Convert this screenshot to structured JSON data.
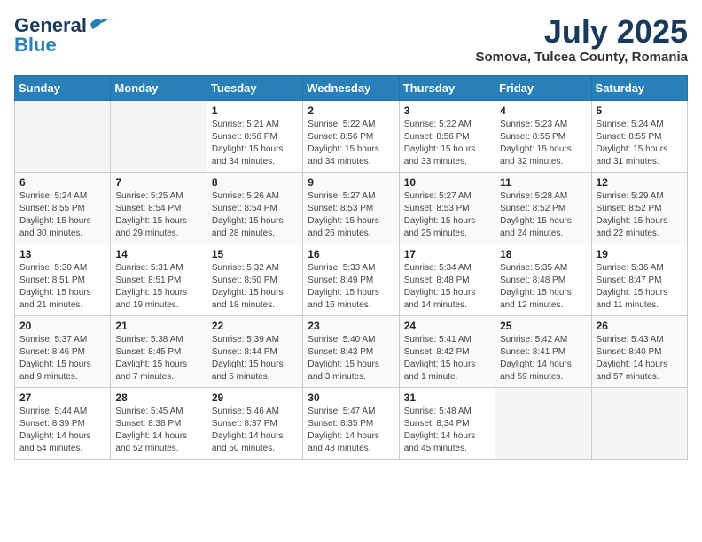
{
  "header": {
    "logo_general": "General",
    "logo_blue": "Blue",
    "title": "July 2025",
    "location": "Somova, Tulcea County, Romania"
  },
  "calendar": {
    "days_of_week": [
      "Sunday",
      "Monday",
      "Tuesday",
      "Wednesday",
      "Thursday",
      "Friday",
      "Saturday"
    ],
    "weeks": [
      [
        {
          "day": "",
          "info": ""
        },
        {
          "day": "",
          "info": ""
        },
        {
          "day": "1",
          "info": "Sunrise: 5:21 AM\nSunset: 8:56 PM\nDaylight: 15 hours and 34 minutes."
        },
        {
          "day": "2",
          "info": "Sunrise: 5:22 AM\nSunset: 8:56 PM\nDaylight: 15 hours and 34 minutes."
        },
        {
          "day": "3",
          "info": "Sunrise: 5:22 AM\nSunset: 8:56 PM\nDaylight: 15 hours and 33 minutes."
        },
        {
          "day": "4",
          "info": "Sunrise: 5:23 AM\nSunset: 8:55 PM\nDaylight: 15 hours and 32 minutes."
        },
        {
          "day": "5",
          "info": "Sunrise: 5:24 AM\nSunset: 8:55 PM\nDaylight: 15 hours and 31 minutes."
        }
      ],
      [
        {
          "day": "6",
          "info": "Sunrise: 5:24 AM\nSunset: 8:55 PM\nDaylight: 15 hours and 30 minutes."
        },
        {
          "day": "7",
          "info": "Sunrise: 5:25 AM\nSunset: 8:54 PM\nDaylight: 15 hours and 29 minutes."
        },
        {
          "day": "8",
          "info": "Sunrise: 5:26 AM\nSunset: 8:54 PM\nDaylight: 15 hours and 28 minutes."
        },
        {
          "day": "9",
          "info": "Sunrise: 5:27 AM\nSunset: 8:53 PM\nDaylight: 15 hours and 26 minutes."
        },
        {
          "day": "10",
          "info": "Sunrise: 5:27 AM\nSunset: 8:53 PM\nDaylight: 15 hours and 25 minutes."
        },
        {
          "day": "11",
          "info": "Sunrise: 5:28 AM\nSunset: 8:52 PM\nDaylight: 15 hours and 24 minutes."
        },
        {
          "day": "12",
          "info": "Sunrise: 5:29 AM\nSunset: 8:52 PM\nDaylight: 15 hours and 22 minutes."
        }
      ],
      [
        {
          "day": "13",
          "info": "Sunrise: 5:30 AM\nSunset: 8:51 PM\nDaylight: 15 hours and 21 minutes."
        },
        {
          "day": "14",
          "info": "Sunrise: 5:31 AM\nSunset: 8:51 PM\nDaylight: 15 hours and 19 minutes."
        },
        {
          "day": "15",
          "info": "Sunrise: 5:32 AM\nSunset: 8:50 PM\nDaylight: 15 hours and 18 minutes."
        },
        {
          "day": "16",
          "info": "Sunrise: 5:33 AM\nSunset: 8:49 PM\nDaylight: 15 hours and 16 minutes."
        },
        {
          "day": "17",
          "info": "Sunrise: 5:34 AM\nSunset: 8:48 PM\nDaylight: 15 hours and 14 minutes."
        },
        {
          "day": "18",
          "info": "Sunrise: 5:35 AM\nSunset: 8:48 PM\nDaylight: 15 hours and 12 minutes."
        },
        {
          "day": "19",
          "info": "Sunrise: 5:36 AM\nSunset: 8:47 PM\nDaylight: 15 hours and 11 minutes."
        }
      ],
      [
        {
          "day": "20",
          "info": "Sunrise: 5:37 AM\nSunset: 8:46 PM\nDaylight: 15 hours and 9 minutes."
        },
        {
          "day": "21",
          "info": "Sunrise: 5:38 AM\nSunset: 8:45 PM\nDaylight: 15 hours and 7 minutes."
        },
        {
          "day": "22",
          "info": "Sunrise: 5:39 AM\nSunset: 8:44 PM\nDaylight: 15 hours and 5 minutes."
        },
        {
          "day": "23",
          "info": "Sunrise: 5:40 AM\nSunset: 8:43 PM\nDaylight: 15 hours and 3 minutes."
        },
        {
          "day": "24",
          "info": "Sunrise: 5:41 AM\nSunset: 8:42 PM\nDaylight: 15 hours and 1 minute."
        },
        {
          "day": "25",
          "info": "Sunrise: 5:42 AM\nSunset: 8:41 PM\nDaylight: 14 hours and 59 minutes."
        },
        {
          "day": "26",
          "info": "Sunrise: 5:43 AM\nSunset: 8:40 PM\nDaylight: 14 hours and 57 minutes."
        }
      ],
      [
        {
          "day": "27",
          "info": "Sunrise: 5:44 AM\nSunset: 8:39 PM\nDaylight: 14 hours and 54 minutes."
        },
        {
          "day": "28",
          "info": "Sunrise: 5:45 AM\nSunset: 8:38 PM\nDaylight: 14 hours and 52 minutes."
        },
        {
          "day": "29",
          "info": "Sunrise: 5:46 AM\nSunset: 8:37 PM\nDaylight: 14 hours and 50 minutes."
        },
        {
          "day": "30",
          "info": "Sunrise: 5:47 AM\nSunset: 8:35 PM\nDaylight: 14 hours and 48 minutes."
        },
        {
          "day": "31",
          "info": "Sunrise: 5:48 AM\nSunset: 8:34 PM\nDaylight: 14 hours and 45 minutes."
        },
        {
          "day": "",
          "info": ""
        },
        {
          "day": "",
          "info": ""
        }
      ]
    ]
  }
}
